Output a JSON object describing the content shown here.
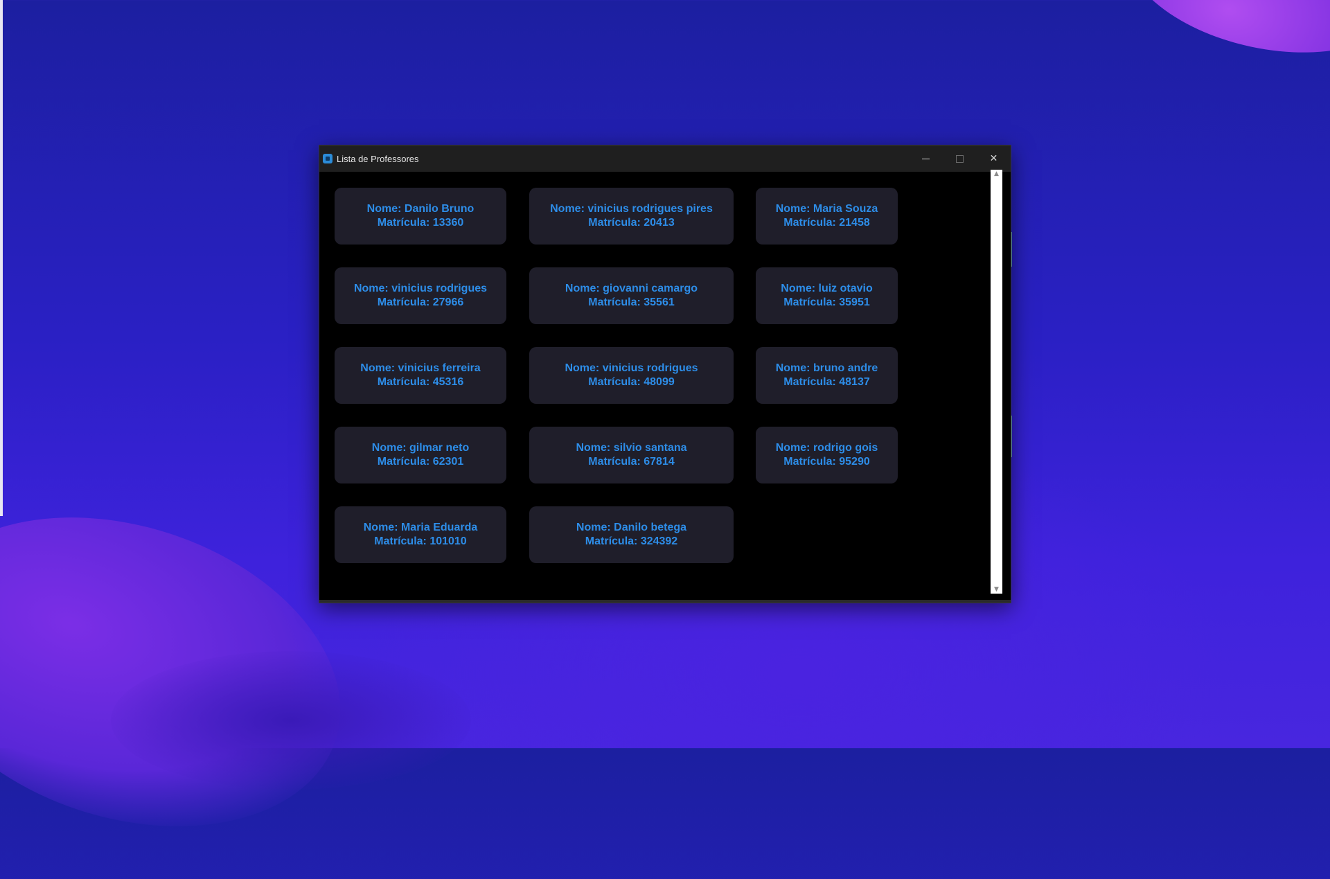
{
  "window": {
    "title": "Lista de Professores",
    "controls": {
      "minimize": "",
      "maximize": "",
      "close": "✕"
    }
  },
  "cards": [
    {
      "nome": "Nome: Danilo Bruno",
      "matricula": "Matrícula: 13360"
    },
    {
      "nome": "Nome: vinicius rodrigues pires",
      "matricula": "Matrícula: 20413"
    },
    {
      "nome": "Nome: Maria Souza",
      "matricula": "Matrícula: 21458"
    },
    {
      "nome": "Nome: vinicius rodrigues",
      "matricula": "Matrícula: 27966"
    },
    {
      "nome": "Nome: giovanni camargo",
      "matricula": "Matrícula: 35561"
    },
    {
      "nome": "Nome: luiz otavio",
      "matricula": "Matrícula: 35951"
    },
    {
      "nome": "Nome: vinicius ferreira",
      "matricula": "Matrícula: 45316"
    },
    {
      "nome": "Nome: vinicius rodrigues",
      "matricula": "Matrícula: 48099"
    },
    {
      "nome": "Nome: bruno andre",
      "matricula": "Matrícula: 48137"
    },
    {
      "nome": "Nome: gilmar neto",
      "matricula": "Matrícula: 62301"
    },
    {
      "nome": "Nome: silvio santana",
      "matricula": "Matrícula: 67814"
    },
    {
      "nome": "Nome: rodrigo gois",
      "matricula": "Matrícula: 95290"
    },
    {
      "nome": "Nome: Maria Eduarda",
      "matricula": "Matrícula: 101010"
    },
    {
      "nome": "Nome: Danilo betega",
      "matricula": "Matrícula: 324392"
    }
  ],
  "scrollbar": {
    "up_arrow": "▲",
    "down_arrow": "▼"
  },
  "colors": {
    "card_text": "#2d8de8",
    "card_background": "#1f1e2a",
    "window_background": "#000000",
    "titlebar_background": "#1f1f1f"
  }
}
